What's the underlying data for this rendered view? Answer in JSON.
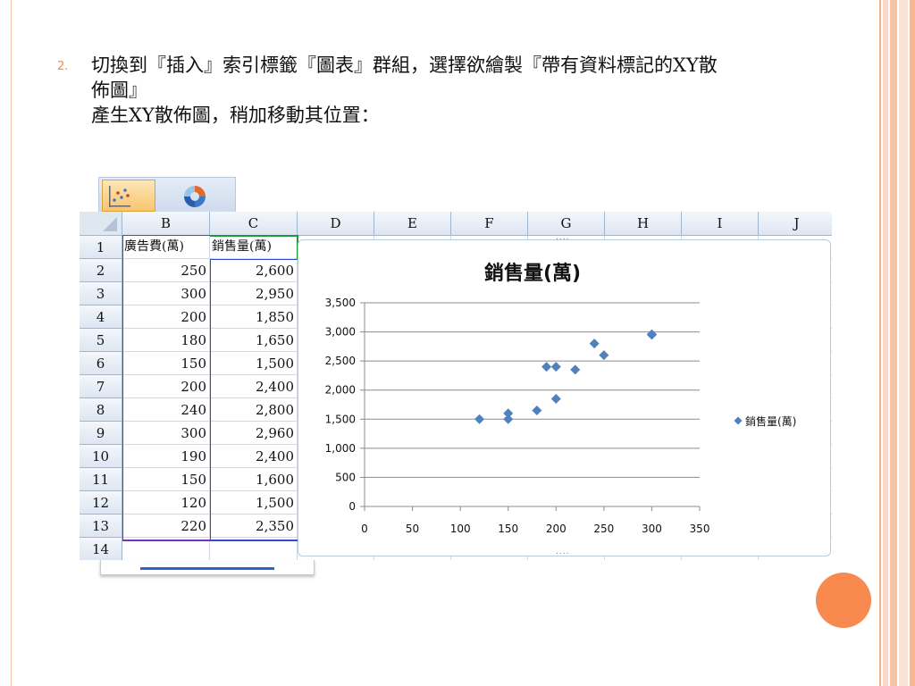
{
  "slide": {
    "bullet_number": "2.",
    "line1": "切換到『插入』索引標籤『圖表』群組，選擇欲繪製『帶有資料標記的XY散",
    "line2": "佈圖』",
    "line3": "產生XY散佈圖，稍加移動其位置："
  },
  "ribbon": {
    "scatter_icon": "scatter-chart-icon",
    "other_icon": "donut-chart-icon"
  },
  "sheet": {
    "columns": [
      "B",
      "C",
      "D",
      "E",
      "F",
      "G",
      "H",
      "I",
      "J"
    ],
    "rows": [
      "1",
      "2",
      "3",
      "4",
      "5",
      "6",
      "7",
      "8",
      "9",
      "10",
      "11",
      "12",
      "13",
      "14"
    ],
    "header_b": "廣告費(萬)",
    "header_c": "銷售量(萬)",
    "col_b": [
      "250",
      "300",
      "200",
      "180",
      "150",
      "200",
      "240",
      "300",
      "190",
      "150",
      "120",
      "220"
    ],
    "col_c": [
      "2,600",
      "2,950",
      "1,850",
      "1,650",
      "1,500",
      "2,400",
      "2,800",
      "2,960",
      "2,400",
      "1,600",
      "1,500",
      "2,350"
    ],
    "selection_colors": {
      "b_range": "#7b2fbe",
      "c_range": "#2d4bd4",
      "header_marker": "#1e9b38"
    }
  },
  "chart_data": {
    "type": "scatter",
    "title": "銷售量(萬)",
    "series": [
      {
        "name": "銷售量(萬)",
        "x": [
          250,
          300,
          200,
          180,
          150,
          200,
          240,
          300,
          190,
          150,
          120,
          220
        ],
        "y": [
          2600,
          2950,
          1850,
          1650,
          1500,
          2400,
          2800,
          2960,
          2400,
          1600,
          1500,
          2350
        ]
      }
    ],
    "xlim": [
      0,
      350
    ],
    "ylim": [
      0,
      3500
    ],
    "xticks": [
      "0",
      "50",
      "100",
      "150",
      "200",
      "250",
      "300",
      "350"
    ],
    "yticks": [
      "0",
      "500",
      "1,000",
      "1,500",
      "2,000",
      "2,500",
      "3,000",
      "3,500"
    ],
    "grid": "horizontal",
    "legend": "right",
    "marker": "diamond",
    "color": "#4f81bd"
  },
  "colors": {
    "accent": "#f98a4f",
    "bullet": "#f08a52"
  }
}
